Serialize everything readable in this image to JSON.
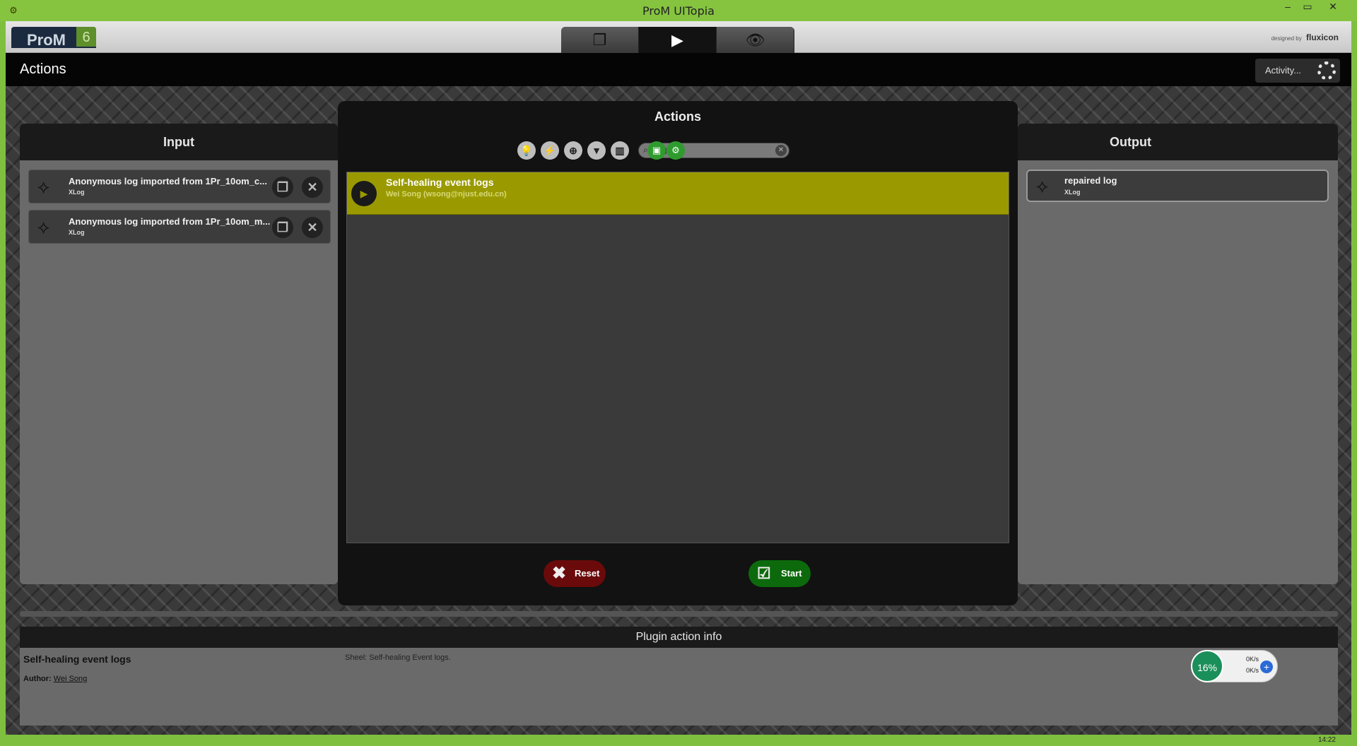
{
  "window": {
    "title": "ProM UITopia",
    "controls": [
      "–",
      "▭",
      "✕"
    ]
  },
  "topbar": {
    "logo_text": "ProM",
    "logo_version": "6",
    "tabs": [
      {
        "icon": "pages-icon",
        "glyph": "❐"
      },
      {
        "icon": "play-icon",
        "glyph": "▶"
      },
      {
        "icon": "eye-icon",
        "glyph": "👁"
      }
    ],
    "designed_by": "designed by",
    "designer": "fluxicon"
  },
  "header": {
    "title": "Actions",
    "activity_label": "Activity..."
  },
  "input_panel": {
    "title": "Input",
    "items": [
      {
        "name": "Anonymous log imported from 1Pr_10om_c...",
        "type": "XLog"
      },
      {
        "name": "Anonymous log imported from 1Pr_10om_m...",
        "type": "XLog"
      }
    ]
  },
  "output_panel": {
    "title": "Output",
    "items": [
      {
        "name": "repaired log",
        "type": "XLog"
      }
    ]
  },
  "dialog": {
    "title": "Actions",
    "search": {
      "value": "Self",
      "placeholder": ""
    },
    "plugins": [
      {
        "name": "Self-healing event logs",
        "author": "Wei Song (wsong@njust.edu.cn)"
      }
    ],
    "reset_label": "Reset",
    "start_label": "Start"
  },
  "info": {
    "title": "Plugin action info",
    "plugin_name": "Self-healing event logs",
    "author_label": "Author:",
    "author_name": "Wei Song",
    "description": "Sheel: Self-healing Event logs."
  },
  "net_widget": {
    "percent": "16%",
    "up": "0K/s",
    "down": "0K/s"
  },
  "taskbar": {
    "clock": "14:22"
  }
}
